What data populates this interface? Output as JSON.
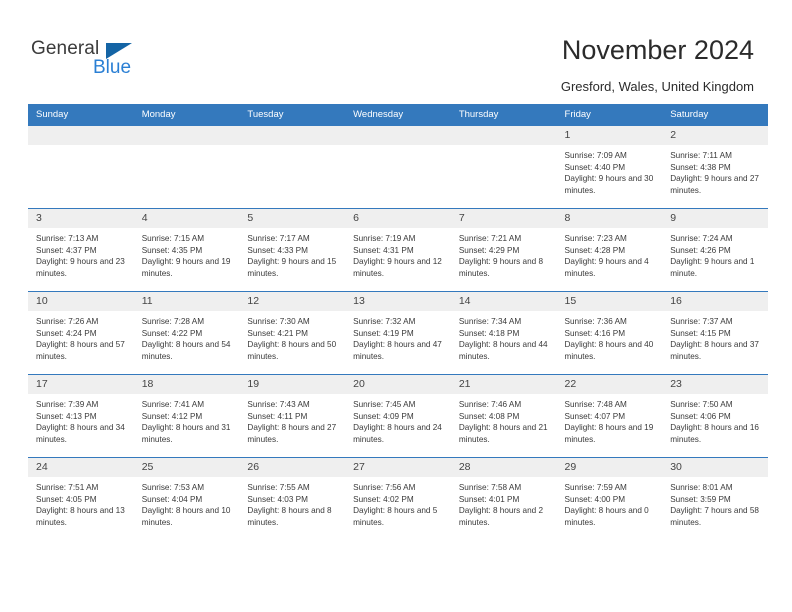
{
  "brand": {
    "name_part1": "General",
    "name_part2": "Blue",
    "triangle_color": "#1464a5",
    "blue_color": "#2a7fd4"
  },
  "header": {
    "title": "November 2024",
    "location": "Gresford, Wales, United Kingdom",
    "header_bg": "#3479bd",
    "daynum_bg": "#efefef"
  },
  "calendar": {
    "weekday_headers": [
      "Sunday",
      "Monday",
      "Tuesday",
      "Wednesday",
      "Thursday",
      "Friday",
      "Saturday"
    ],
    "labels": {
      "sunrise": "Sunrise:",
      "sunset": "Sunset:",
      "daylight": "Daylight:"
    },
    "weeks": [
      [
        {
          "day": "",
          "blank": true
        },
        {
          "day": "",
          "blank": true
        },
        {
          "day": "",
          "blank": true
        },
        {
          "day": "",
          "blank": true
        },
        {
          "day": "",
          "blank": true
        },
        {
          "day": "1",
          "sunrise": "Sunrise: 7:09 AM",
          "sunset": "Sunset: 4:40 PM",
          "daylight": "Daylight: 9 hours and 30 minutes."
        },
        {
          "day": "2",
          "sunrise": "Sunrise: 7:11 AM",
          "sunset": "Sunset: 4:38 PM",
          "daylight": "Daylight: 9 hours and 27 minutes."
        }
      ],
      [
        {
          "day": "3",
          "sunrise": "Sunrise: 7:13 AM",
          "sunset": "Sunset: 4:37 PM",
          "daylight": "Daylight: 9 hours and 23 minutes."
        },
        {
          "day": "4",
          "sunrise": "Sunrise: 7:15 AM",
          "sunset": "Sunset: 4:35 PM",
          "daylight": "Daylight: 9 hours and 19 minutes."
        },
        {
          "day": "5",
          "sunrise": "Sunrise: 7:17 AM",
          "sunset": "Sunset: 4:33 PM",
          "daylight": "Daylight: 9 hours and 15 minutes."
        },
        {
          "day": "6",
          "sunrise": "Sunrise: 7:19 AM",
          "sunset": "Sunset: 4:31 PM",
          "daylight": "Daylight: 9 hours and 12 minutes."
        },
        {
          "day": "7",
          "sunrise": "Sunrise: 7:21 AM",
          "sunset": "Sunset: 4:29 PM",
          "daylight": "Daylight: 9 hours and 8 minutes."
        },
        {
          "day": "8",
          "sunrise": "Sunrise: 7:23 AM",
          "sunset": "Sunset: 4:28 PM",
          "daylight": "Daylight: 9 hours and 4 minutes."
        },
        {
          "day": "9",
          "sunrise": "Sunrise: 7:24 AM",
          "sunset": "Sunset: 4:26 PM",
          "daylight": "Daylight: 9 hours and 1 minute."
        }
      ],
      [
        {
          "day": "10",
          "sunrise": "Sunrise: 7:26 AM",
          "sunset": "Sunset: 4:24 PM",
          "daylight": "Daylight: 8 hours and 57 minutes."
        },
        {
          "day": "11",
          "sunrise": "Sunrise: 7:28 AM",
          "sunset": "Sunset: 4:22 PM",
          "daylight": "Daylight: 8 hours and 54 minutes."
        },
        {
          "day": "12",
          "sunrise": "Sunrise: 7:30 AM",
          "sunset": "Sunset: 4:21 PM",
          "daylight": "Daylight: 8 hours and 50 minutes."
        },
        {
          "day": "13",
          "sunrise": "Sunrise: 7:32 AM",
          "sunset": "Sunset: 4:19 PM",
          "daylight": "Daylight: 8 hours and 47 minutes."
        },
        {
          "day": "14",
          "sunrise": "Sunrise: 7:34 AM",
          "sunset": "Sunset: 4:18 PM",
          "daylight": "Daylight: 8 hours and 44 minutes."
        },
        {
          "day": "15",
          "sunrise": "Sunrise: 7:36 AM",
          "sunset": "Sunset: 4:16 PM",
          "daylight": "Daylight: 8 hours and 40 minutes."
        },
        {
          "day": "16",
          "sunrise": "Sunrise: 7:37 AM",
          "sunset": "Sunset: 4:15 PM",
          "daylight": "Daylight: 8 hours and 37 minutes."
        }
      ],
      [
        {
          "day": "17",
          "sunrise": "Sunrise: 7:39 AM",
          "sunset": "Sunset: 4:13 PM",
          "daylight": "Daylight: 8 hours and 34 minutes."
        },
        {
          "day": "18",
          "sunrise": "Sunrise: 7:41 AM",
          "sunset": "Sunset: 4:12 PM",
          "daylight": "Daylight: 8 hours and 31 minutes."
        },
        {
          "day": "19",
          "sunrise": "Sunrise: 7:43 AM",
          "sunset": "Sunset: 4:11 PM",
          "daylight": "Daylight: 8 hours and 27 minutes."
        },
        {
          "day": "20",
          "sunrise": "Sunrise: 7:45 AM",
          "sunset": "Sunset: 4:09 PM",
          "daylight": "Daylight: 8 hours and 24 minutes."
        },
        {
          "day": "21",
          "sunrise": "Sunrise: 7:46 AM",
          "sunset": "Sunset: 4:08 PM",
          "daylight": "Daylight: 8 hours and 21 minutes."
        },
        {
          "day": "22",
          "sunrise": "Sunrise: 7:48 AM",
          "sunset": "Sunset: 4:07 PM",
          "daylight": "Daylight: 8 hours and 19 minutes."
        },
        {
          "day": "23",
          "sunrise": "Sunrise: 7:50 AM",
          "sunset": "Sunset: 4:06 PM",
          "daylight": "Daylight: 8 hours and 16 minutes."
        }
      ],
      [
        {
          "day": "24",
          "sunrise": "Sunrise: 7:51 AM",
          "sunset": "Sunset: 4:05 PM",
          "daylight": "Daylight: 8 hours and 13 minutes."
        },
        {
          "day": "25",
          "sunrise": "Sunrise: 7:53 AM",
          "sunset": "Sunset: 4:04 PM",
          "daylight": "Daylight: 8 hours and 10 minutes."
        },
        {
          "day": "26",
          "sunrise": "Sunrise: 7:55 AM",
          "sunset": "Sunset: 4:03 PM",
          "daylight": "Daylight: 8 hours and 8 minutes."
        },
        {
          "day": "27",
          "sunrise": "Sunrise: 7:56 AM",
          "sunset": "Sunset: 4:02 PM",
          "daylight": "Daylight: 8 hours and 5 minutes."
        },
        {
          "day": "28",
          "sunrise": "Sunrise: 7:58 AM",
          "sunset": "Sunset: 4:01 PM",
          "daylight": "Daylight: 8 hours and 2 minutes."
        },
        {
          "day": "29",
          "sunrise": "Sunrise: 7:59 AM",
          "sunset": "Sunset: 4:00 PM",
          "daylight": "Daylight: 8 hours and 0 minutes."
        },
        {
          "day": "30",
          "sunrise": "Sunrise: 8:01 AM",
          "sunset": "Sunset: 3:59 PM",
          "daylight": "Daylight: 7 hours and 58 minutes."
        }
      ]
    ]
  }
}
